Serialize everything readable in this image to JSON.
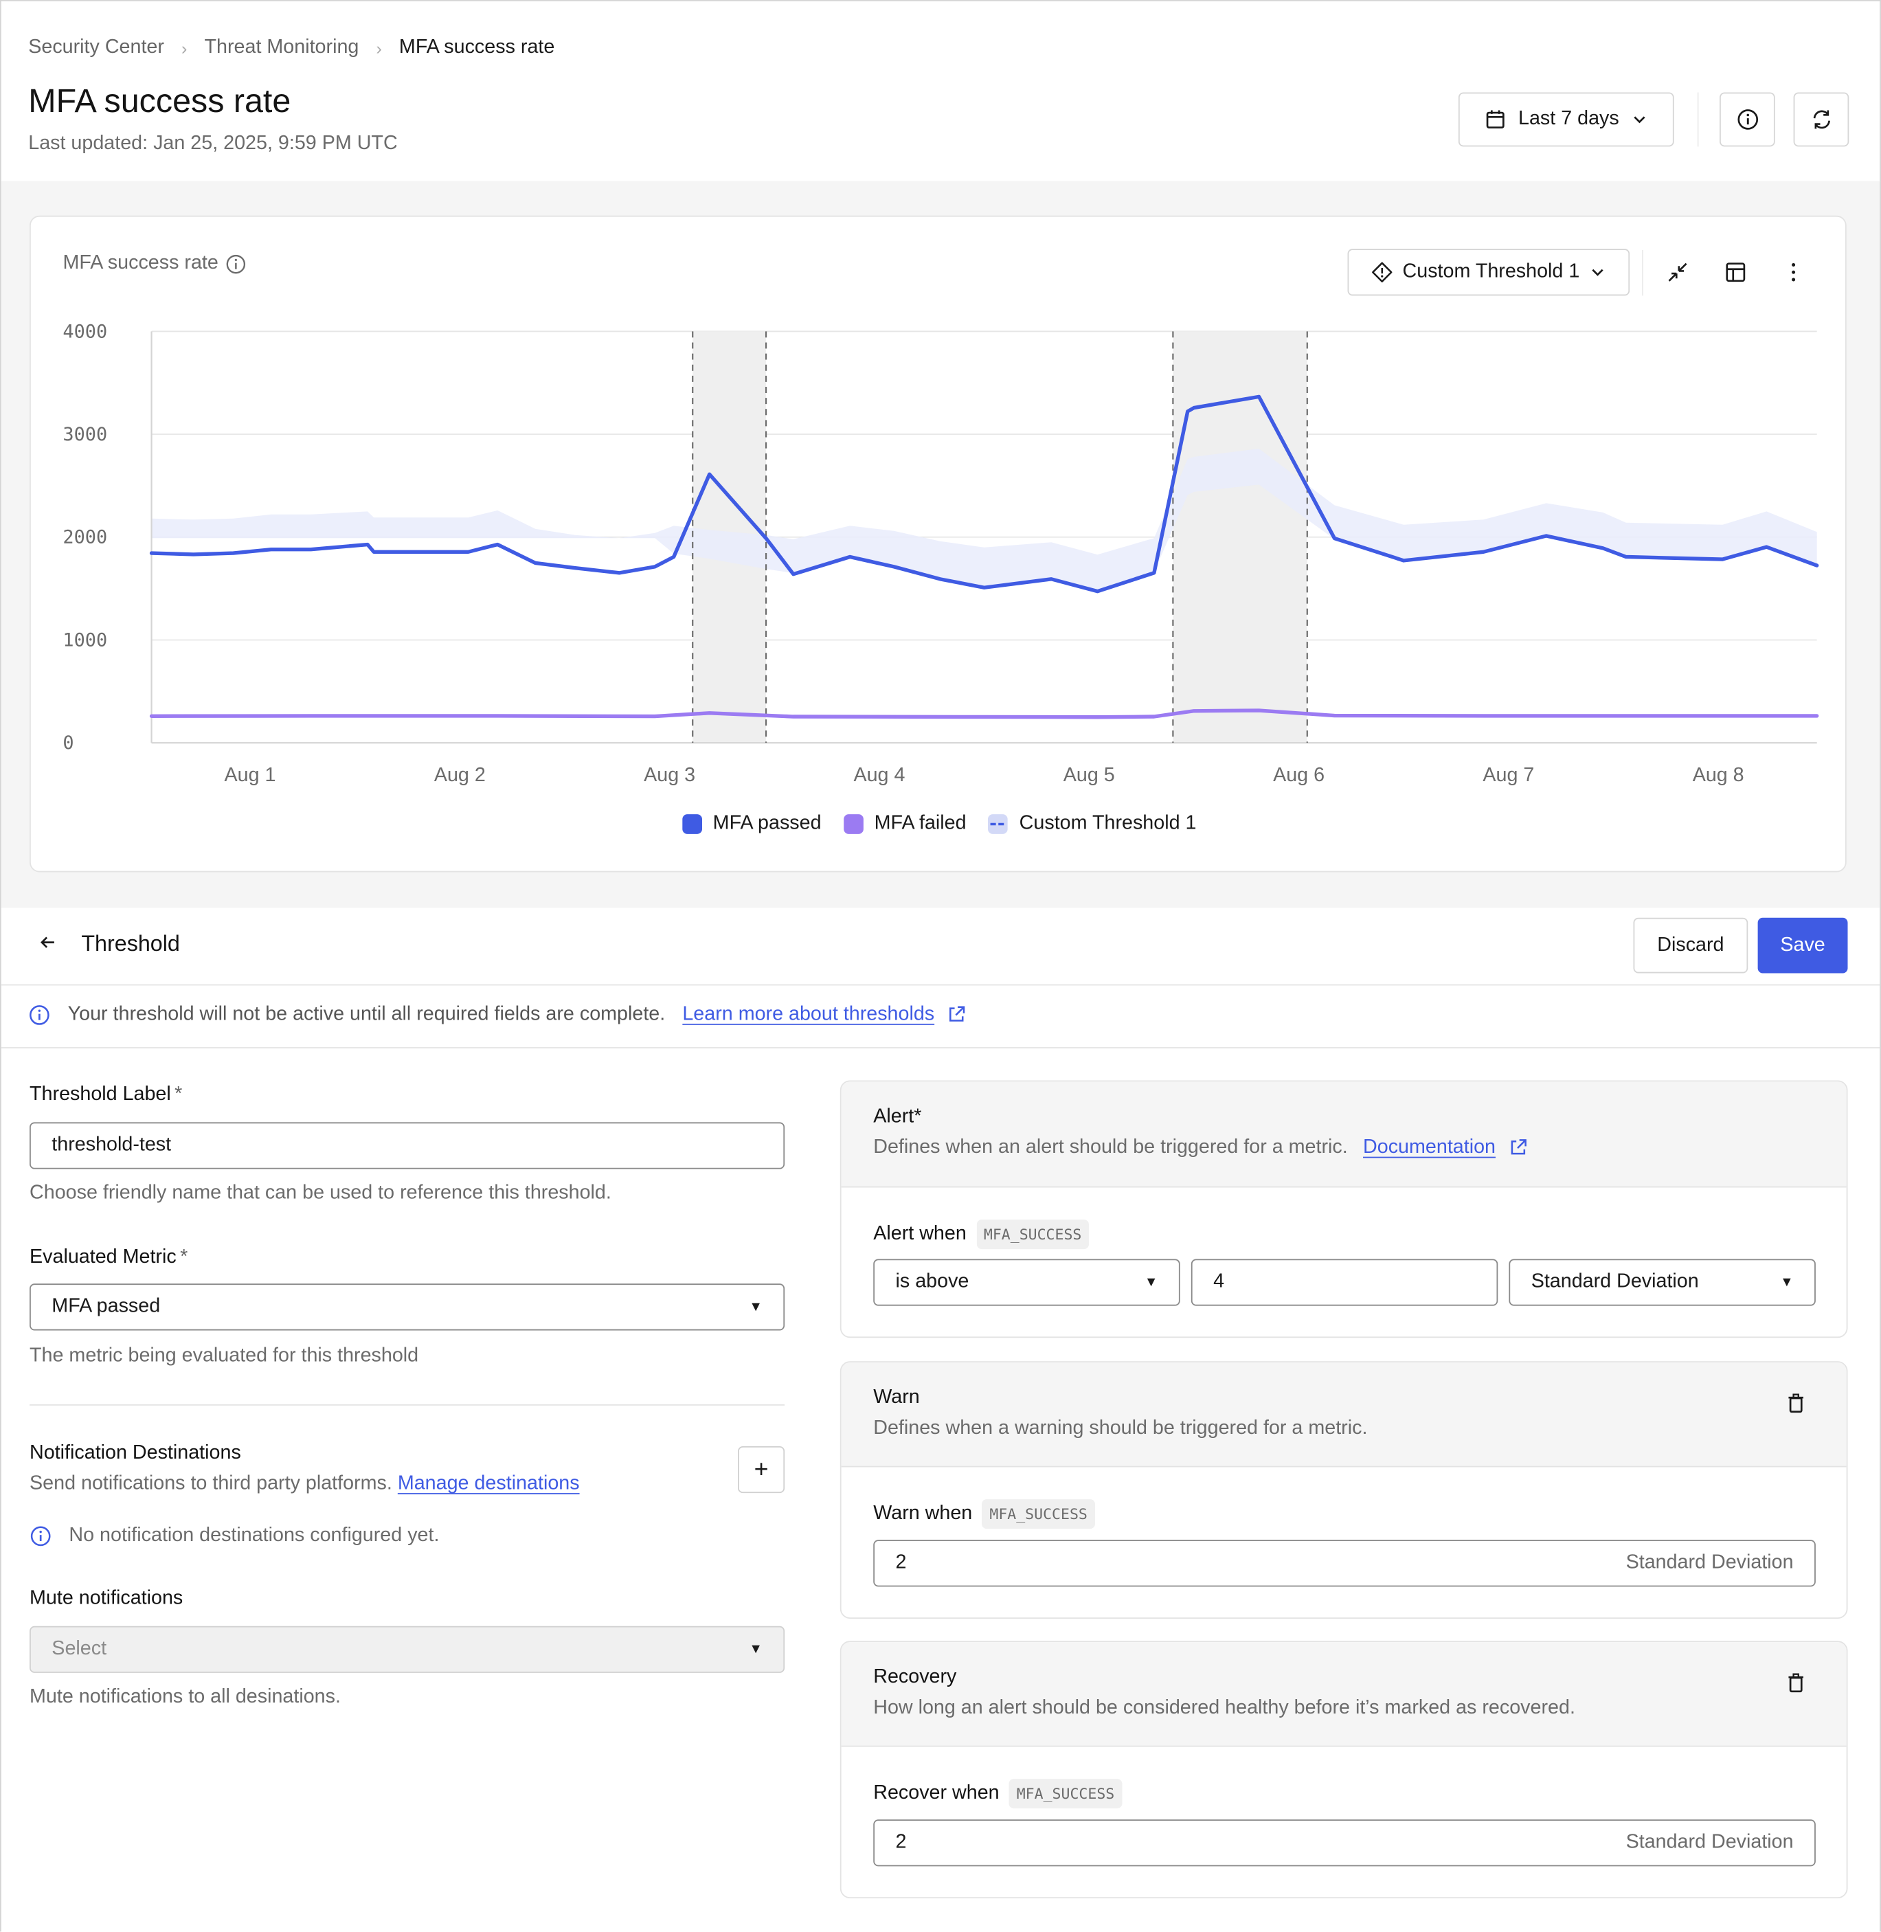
{
  "breadcrumb": [
    "Security Center",
    "Threat Monitoring",
    "MFA success rate"
  ],
  "header": {
    "title": "MFA success rate",
    "last_updated": "Last updated: Jan 25, 2025, 9:59 PM UTC",
    "range_label": "Last 7 days",
    "icons": {
      "range": "calendar-icon",
      "info": "info-icon",
      "refresh": "refresh-icon"
    }
  },
  "chart_card": {
    "title": "MFA success rate",
    "threshold_selector": "Custom Threshold 1",
    "toolbar_icons": [
      "collapse-icon",
      "table-icon",
      "more-vertical-icon"
    ]
  },
  "colors": {
    "passed": "#3f5be3",
    "failed": "#9b7bf2",
    "band": "#e9ecfb",
    "band_overlap": "#dfe2ee",
    "anomaly": "#efefef",
    "accent": "#3f5be3"
  },
  "chart_data": {
    "type": "line",
    "title": "MFA success rate",
    "xlabel": "",
    "ylabel": "",
    "ylim": [
      0,
      4000
    ],
    "yticks": [
      "0",
      "1000",
      "2000",
      "3000",
      "4000"
    ],
    "xlim": [
      0.53,
      8.47
    ],
    "xticks": [
      {
        "x": 1,
        "label": "Aug 1"
      },
      {
        "x": 2,
        "label": "Aug 2"
      },
      {
        "x": 3,
        "label": "Aug 3"
      },
      {
        "x": 4,
        "label": "Aug 4"
      },
      {
        "x": 5,
        "label": "Aug 5"
      },
      {
        "x": 6,
        "label": "Aug 6"
      },
      {
        "x": 7,
        "label": "Aug 7"
      },
      {
        "x": 8,
        "label": "Aug 8"
      }
    ],
    "grid": true,
    "legend_position": "bottom-center",
    "series": [
      {
        "name": "MFA passed",
        "x": [
          0.53,
          0.73,
          0.92,
          1.1,
          1.29,
          1.56,
          1.59,
          2.04,
          2.18,
          2.36,
          2.55,
          2.76,
          2.93,
          3.02,
          3.19,
          3.46,
          3.59,
          3.86,
          4.07,
          4.29,
          4.5,
          4.82,
          5.04,
          5.31,
          5.47,
          5.5,
          5.81,
          6.17,
          6.5,
          6.88,
          7.18,
          7.45,
          7.56,
          8.02,
          8.23,
          8.47
        ],
        "y": [
          1844,
          1832,
          1844,
          1880,
          1880,
          1928,
          1856,
          1856,
          1928,
          1748,
          1700,
          1652,
          1712,
          1808,
          2611,
          1988,
          1640,
          1808,
          1712,
          1592,
          1509,
          1592,
          1473,
          1652,
          3222,
          3257,
          3365,
          1988,
          1772,
          1856,
          2012,
          1892,
          1808,
          1784,
          1904,
          1724
        ]
      },
      {
        "name": "MFA failed",
        "x": [
          0.53,
          1.29,
          2.18,
          2.93,
          3.19,
          3.59,
          4.5,
          5.04,
          5.31,
          5.5,
          5.81,
          6.17,
          7.0,
          8.47
        ],
        "y": [
          260,
          262,
          262,
          258,
          290,
          255,
          252,
          250,
          255,
          310,
          315,
          265,
          262,
          262
        ]
      },
      {
        "name": "Custom Threshold 1",
        "kind": "band",
        "x": [
          0.53,
          0.73,
          0.92,
          1.1,
          1.29,
          1.56,
          1.59,
          2.04,
          2.18,
          2.36,
          2.55,
          2.76,
          2.93,
          3.02,
          3.19,
          3.46,
          3.59,
          3.86,
          4.07,
          4.29,
          4.5,
          4.82,
          5.04,
          5.31,
          5.47,
          5.5,
          5.81,
          6.17,
          6.5,
          6.88,
          7.18,
          7.45,
          7.56,
          8.02,
          8.23,
          8.47
        ],
        "upper": [
          2180,
          2170,
          2180,
          2220,
          2220,
          2250,
          2190,
          2190,
          2260,
          2080,
          2020,
          1990,
          2040,
          2110,
          2070,
          2020,
          1980,
          2110,
          2060,
          1960,
          1900,
          1950,
          1830,
          1990,
          2760,
          2780,
          2860,
          2310,
          2120,
          2170,
          2330,
          2240,
          2140,
          2120,
          2250,
          2050
        ],
        "lower": [
          1990,
          1990,
          1990,
          1990,
          1990,
          1990,
          1990,
          1990,
          1990,
          1990,
          1990,
          1990,
          1990,
          1840,
          1790,
          1690,
          1650,
          1790,
          1700,
          1600,
          1510,
          1600,
          1490,
          1660,
          2410,
          2440,
          2510,
          1980,
          1790,
          1860,
          2000,
          1900,
          1820,
          1800,
          1900,
          1730
        ]
      }
    ],
    "anomaly_windows": [
      [
        3.11,
        3.46
      ],
      [
        5.4,
        6.04
      ]
    ]
  },
  "legend": [
    {
      "label": "MFA passed",
      "color": "#3f5be3"
    },
    {
      "label": "MFA failed",
      "color": "#9b7bf2"
    },
    {
      "label": "Custom Threshold 1",
      "color": "#d3d9f7"
    }
  ],
  "threshold": {
    "back_label": "Threshold",
    "discard_label": "Discard",
    "save_label": "Save",
    "notice": "Your threshold will not be active until all required fields are complete.",
    "notice_link": "Learn more about thresholds",
    "label_field": {
      "label": "Threshold Label",
      "required": "*",
      "value": "threshold-test",
      "help": "Choose friendly name that can be used to reference this threshold."
    },
    "metric_field": {
      "label": "Evaluated Metric",
      "required": "*",
      "value": "MFA passed",
      "help": "The metric being evaluated for this threshold"
    },
    "notifications": {
      "title": "Notification Destinations",
      "desc": "Send notifications to third party platforms.",
      "link": "Manage destinations",
      "empty": "No notification destinations configured yet.",
      "add_label": "+"
    },
    "mute": {
      "label": "Mute notifications",
      "placeholder": "Select",
      "help": "Mute notifications to all desinations."
    },
    "alert": {
      "title": "Alert*",
      "desc": "Defines when an alert should be triggered for a metric.",
      "link": "Documentation",
      "when_label": "Alert when",
      "metric_code": "MFA_SUCCESS",
      "operator": "is above",
      "value": "4",
      "unit": "Standard Deviation"
    },
    "warn": {
      "title": "Warn",
      "desc": "Defines when a warning should be triggered for a metric.",
      "when_label": "Warn when",
      "metric_code": "MFA_SUCCESS",
      "value": "2",
      "unit": "Standard Deviation"
    },
    "recovery": {
      "title": "Recovery",
      "desc": "How long an alert should be considered healthy before it’s marked as recovered.",
      "when_label": "Recover when",
      "metric_code": "MFA_SUCCESS",
      "value": "2",
      "unit": "Standard Deviation"
    }
  }
}
